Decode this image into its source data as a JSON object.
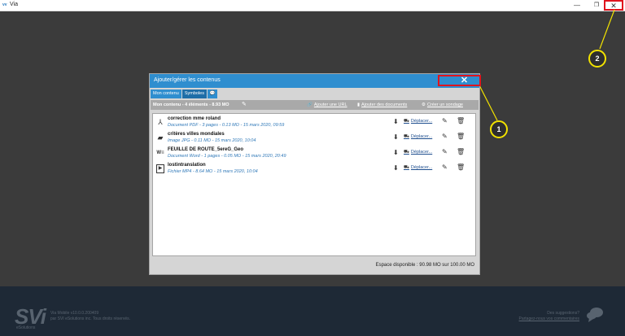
{
  "window": {
    "app_logo": "vv",
    "title": "Via",
    "minimize": "—",
    "maximize": "❐",
    "close": "✕"
  },
  "dialog": {
    "title": "Ajouter/gérer les contenus",
    "close": "✕",
    "tabs": [
      {
        "label": "Mon contenu"
      },
      {
        "label": "Symboles"
      },
      {
        "label": "💬"
      }
    ],
    "toolbar": {
      "title": "Mon contenu - 4 éléments - 8.93 MO",
      "edit_icon": "✎",
      "add_url": "Ajouter une URL",
      "add_url_icon": "🔗",
      "add_docs": "Ajouter des documents",
      "add_docs_icon": "▮",
      "create_poll": "Créer un sondage",
      "create_poll_icon": "⚙"
    },
    "items": [
      {
        "icon": "pdf-icon",
        "glyph": "⅄",
        "name": "correction mme roland",
        "meta": "Document PDF - 3 pages - 0.13 MO - 15 mars 2020, 09:59",
        "move": "Déplacer..."
      },
      {
        "icon": "image-icon",
        "glyph": "▰",
        "name": "critères villes mondiales",
        "meta": "Image JPG - 0.11 MO - 15 mars 2020, 10:04",
        "move": "Déplacer..."
      },
      {
        "icon": "word-icon",
        "glyph": "W≡",
        "name": "FEUILLE DE ROUTE_5ereG_Geo",
        "meta": "Document Word - 1 pages - 0.05 MO - 15 mars 2020, 20:49",
        "move": "Déplacer..."
      },
      {
        "icon": "video-icon",
        "glyph": "▶",
        "name": "lostintranslation",
        "meta": "Fichier MP4 - 8.64 MO - 15 mars 2020, 10:04",
        "move": "Déplacer..."
      }
    ],
    "row_glyphs": {
      "download": "⬇",
      "move": "⛟",
      "edit": "✎",
      "delete": "🗑"
    },
    "space": "Espace disponible : 90.98 MO sur 100.00 MO"
  },
  "footer": {
    "logo": "SVi",
    "logo_sub": "eSolutions",
    "version_line1": "Via Mobile v10.0.0.200409",
    "version_line2": "par SVI eSolutions inc. Tous droits réservés.",
    "suggest_line1": "Des suggestions?",
    "suggest_line2": "Partagez-nous vos commentaires"
  },
  "callouts": {
    "one": "1",
    "two": "2"
  },
  "colors": {
    "accent": "#2f8ecf",
    "highlight": "#e0141e",
    "callout": "#f2e200"
  }
}
